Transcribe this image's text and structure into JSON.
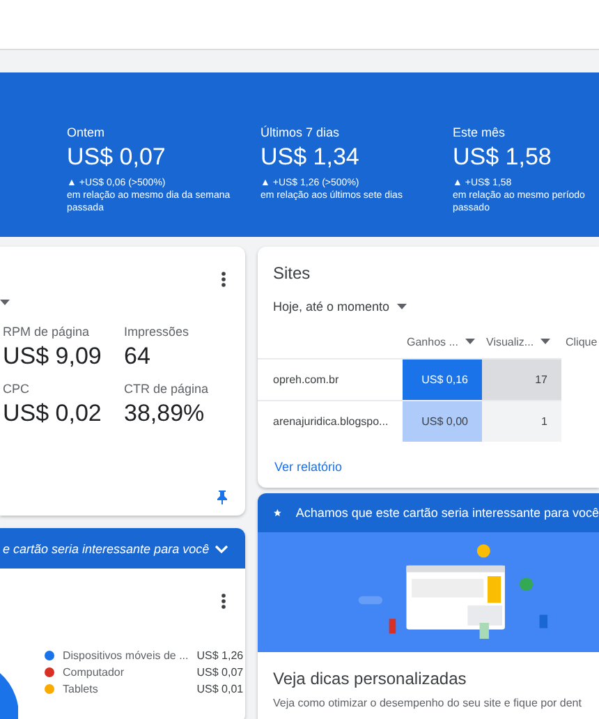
{
  "summary": [
    {
      "label": "Ontem",
      "value": "US$ 0,07",
      "change": "▲ +US$ 0,06 (>500%)",
      "comparison": [
        "em relação ao mesmo dia da semana",
        "passada"
      ]
    },
    {
      "label": "Últimos 7 dias",
      "value": "US$ 1,34",
      "change": "▲ +US$ 1,26 (>500%)",
      "comparison": [
        "em relação aos últimos sete dias"
      ]
    },
    {
      "label": "Este mês",
      "value": "US$ 1,58",
      "change": "▲ +US$ 1,58",
      "comparison": [
        "em relação ao mesmo período",
        "passado"
      ]
    }
  ],
  "performance_card": {
    "metrics": [
      {
        "label": "RPM de página",
        "value": "US$ 9,09"
      },
      {
        "label": "Impressões",
        "value": "64"
      },
      {
        "label": "CPC",
        "value": "US$ 0,02"
      },
      {
        "label": "CTR de página",
        "value": "38,89%"
      }
    ]
  },
  "sites_card": {
    "title": "Sites",
    "period": "Hoje, até o momento",
    "columns": [
      "Ganhos ...",
      "Visualiz...",
      "Clique"
    ],
    "rows": [
      {
        "site": "opreh.com.br",
        "cells": [
          {
            "value": "US$ 0,16",
            "color": "#1a73e8"
          },
          {
            "value": "17",
            "color": "#dadce0"
          }
        ]
      },
      {
        "site": "arenajuridica.blogspo...",
        "cells": [
          {
            "value": "US$ 0,00",
            "color": "#aecbfa"
          },
          {
            "value": "1",
            "color": "#f1f3f4"
          }
        ]
      }
    ],
    "link": "Ver relatório"
  },
  "devices_card": {
    "banner": "e cartão seria interessante para você",
    "legend": [
      {
        "label": "Dispositivos móveis de ...",
        "value": "US$ 1,26",
        "color": "#1a73e8"
      },
      {
        "label": "Computador",
        "value": "US$ 0,07",
        "color": "#d93025"
      },
      {
        "label": "Tablets",
        "value": "US$ 0,01",
        "color": "#f9ab00"
      }
    ]
  },
  "tip_card": {
    "banner": "Achamos que este cartão seria interessante para você",
    "title": "Veja dicas personalizadas",
    "body": "Veja como otimizar o desempenho do seu site e fique por dent"
  }
}
